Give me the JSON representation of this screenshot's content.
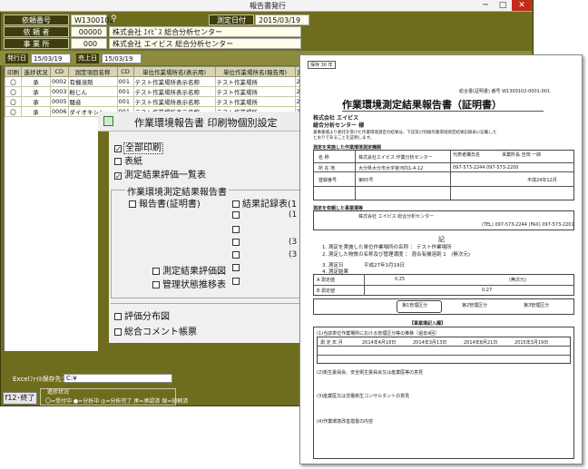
{
  "window": {
    "title": "報告書発行",
    "controls": {
      "minimize": "─",
      "maximize": "□",
      "close": "✕"
    }
  },
  "header": {
    "request_no_label": "依頼番号",
    "request_no": "W1300102",
    "measure_date_label": "測定日付",
    "measure_date": "2015/03/19",
    "requester_label": "依 頼 者",
    "requester_code": "00000",
    "requester_name": "株式会社 ｴｲﾋﾞｽ 総合分析センター",
    "office_label": "事 業 所",
    "office_code": "000",
    "office_name": "株式会社 エイビス 総合分析センター",
    "binoculars_icon": "binoculars-icon"
  },
  "filter": {
    "issue_date_label": "発行日",
    "issue_date": "15/03/19",
    "sales_date_label": "売上日",
    "sales_date": "15/03/19"
  },
  "table": {
    "columns": [
      "印刷",
      "進捗状況",
      "CD",
      "測定項目名称",
      "CD",
      "単位作業場所名(表示用)",
      "単位作業場所名(報告用)",
      "測定日"
    ],
    "rows": [
      [
        "〇",
        "承",
        "0002",
        "有機溶剤",
        "001",
        "テスト作業場所表示名称",
        "テスト作業場所",
        "2015/"
      ],
      [
        "〇",
        "承",
        "0003",
        "粉じん",
        "001",
        "テスト作業場所表示名称",
        "テスト作業場所",
        "2015/"
      ],
      [
        "〇",
        "承",
        "0005",
        "騒音",
        "001",
        "テスト作業場所表示名称",
        "テスト作業場所",
        "2015/"
      ],
      [
        "〇",
        "承",
        "0006",
        "ダイオキシン",
        "001",
        "テスト作業場所表示名称",
        "テスト作業場所",
        "2015/"
      ]
    ]
  },
  "footer": {
    "excel_label": "Excelﾌｧｲﾙ保存先：",
    "excel_path": "C:¥",
    "f12_label": "f12･終了",
    "status_title": "進捗状況",
    "status_text": "〇=受付中 ●=分析中 ◎=分析完了 承=承認済 保=印刷済"
  },
  "dialog": {
    "title": "作業環境報告書 印刷物個別設定",
    "all_print": "全部印刷",
    "cover": "表紙",
    "eval_list": "測定結果評価一覧表",
    "group_title": "作業環境測定結果報告書",
    "report_cert": "報告書(証明書)",
    "result_record": "結果記録表(1",
    "partial_1": "(1",
    "partial_3a": "(3",
    "partial_3b": "(3",
    "result_eval_chart": "測定結果評価図",
    "mgmt_trend": "管理状態推移表",
    "eval_dist": "評価分布図",
    "comment_sheet": "総合コメント帳票",
    "check_mark": "✓"
  },
  "report": {
    "keep_label": "保存 30 年",
    "doc_no": "総合書(証明書) 番号 W1300102-0001-001",
    "title": "作業環境測定結果報告書（証明書）",
    "company_1": "株式会社 エイビス",
    "company_2": "総合分析センター 様",
    "intro_1": "貴事業場より委託を受けた作業環境測定の結果は、下記及び別紙作業環境測定結果記録表に記載した",
    "intro_2": "とおりであることを証明します。",
    "sec_org": "測定を実施した作業環境測定機関",
    "org_name_label": "名 称",
    "org_name": "株式会社エイビス 作業分析センター",
    "rep_label": "代表者職氏名",
    "rep_value": "事業所長 吉田 一郎",
    "addr_label": "所 在 地",
    "addr_value": "大分県大分市大字宮河内1-4-12",
    "tel_value": "097-573-2244 097-573-2200",
    "reg_label": "登録番号",
    "reg_value": "第65号",
    "reg_date": "平成24年12月",
    "sec_site": "測定を依頼した事業場等",
    "site_name": "株式会社 エイビス 総合分析センター",
    "site_tel": "(TEL) 097-573-2244 (FAX) 097-573-2201",
    "ki": "記",
    "item_1": "1. 測定を実施した単位作業場所の名称 ： テスト作業場所",
    "item_2": "2. 測定した物質の名称及び管理濃度 ： 混合有機溶剤 1　(無次元)",
    "item_3": "3. 測定日",
    "item_3_date": "平成27年3月19日",
    "item_4": "4. 測定結果",
    "row_a": "A 測定値",
    "row_b": "B 測定値",
    "val_a": "0.25",
    "val_b": "0.27",
    "unit": "(無次元)",
    "cls_1": "第1管理区分",
    "cls_2": "第2管理区分",
    "cls_3": "第3管理区分",
    "sec_note": "【事業場記入欄】",
    "note_1": "(1)当該単位作業場所における管理区分等の推移（過去4回）",
    "hist_label": "測 定 年 月",
    "hist_1": "2014年4月18日",
    "hist_2": "2014年3月13日",
    "hist_3": "2014年8月21日",
    "hist_4": "2015年3月19日",
    "note_2": "(2)衛生委員会、安全衛生委員会又は産業医等の意見",
    "note_3": "(3)産業医又は労働衛生コンサルタントの意見",
    "note_4": "(4)作業環境改善措置の内容"
  },
  "colors": {
    "window_bg": "#6e6d1e",
    "label_bg": "#3e3d0e",
    "value_bg": "#fffde9",
    "close_red": "#c42b1c"
  }
}
